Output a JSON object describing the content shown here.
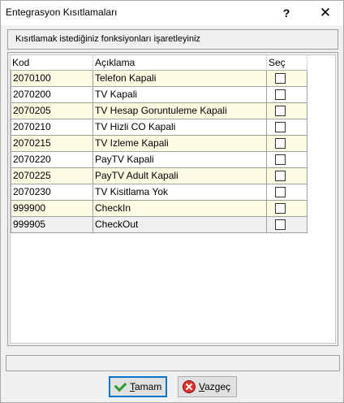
{
  "window": {
    "title": "Entegrasyon Kısıtlamaları",
    "help_glyph": "?",
    "close_glyph": "✕"
  },
  "instruction": "Kısıtlamak istediğiniz fonksiyonları işaretleyiniz",
  "table": {
    "headers": {
      "code": "Kod",
      "description": "Açıklama",
      "select": "Seç"
    },
    "rows": [
      {
        "code": "2070100",
        "description": "Telefon Kapali",
        "checked": false
      },
      {
        "code": "2070200",
        "description": "TV Kapali",
        "checked": false
      },
      {
        "code": "2070205",
        "description": "TV Hesap Goruntuleme Kapali",
        "checked": false
      },
      {
        "code": "2070210",
        "description": "TV Hizli CO Kapali",
        "checked": false
      },
      {
        "code": "2070215",
        "description": "TV Izleme Kapali",
        "checked": false
      },
      {
        "code": "2070220",
        "description": "PayTV Kapali",
        "checked": false
      },
      {
        "code": "2070225",
        "description": "PayTV Adult Kapali",
        "checked": false
      },
      {
        "code": "2070230",
        "description": "TV Kisitlama Yok",
        "checked": false
      },
      {
        "code": "999900",
        "description": "CheckIn",
        "checked": false
      },
      {
        "code": "999905",
        "description": "CheckOut",
        "checked": false
      }
    ]
  },
  "buttons": {
    "ok": {
      "accel": "T",
      "rest": "amam",
      "icon": "check-icon"
    },
    "cancel": {
      "accel": "V",
      "rest": "azgeç",
      "icon": "cancel-icon"
    }
  },
  "colors": {
    "row_alt": "#fdfce3",
    "row_plain": "#ffffff",
    "row_last": "#efefef",
    "ok_border": "#0078d7"
  }
}
